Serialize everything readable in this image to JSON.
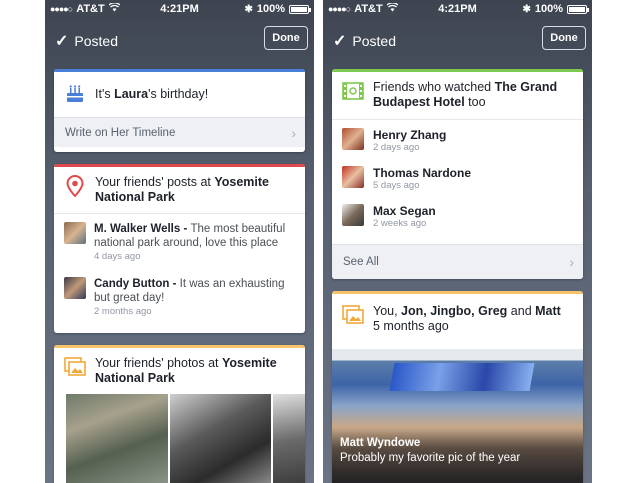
{
  "status": {
    "carrier": "AT&T",
    "time": "4:21PM",
    "battery": "100%"
  },
  "nav": {
    "title": "Posted",
    "done_label": "Done"
  },
  "left": {
    "birthday": {
      "text_prefix": "It's ",
      "name": "Laura",
      "text_suffix": "'s birthday!",
      "footer": "Write on Her Timeline",
      "accent": "#4a7fd8"
    },
    "posts_card": {
      "title_prefix": "Your friends' posts at ",
      "place": "Yosemite National Park",
      "accent": "#e0494b",
      "posts": [
        {
          "name": "M. Walker Wells",
          "sep": " - ",
          "text": "The most beautiful national park around, love this place",
          "time": "4 days ago"
        },
        {
          "name": "Candy Button",
          "sep": " - ",
          "text": "It was an exhausting but great day!",
          "time": "2 months ago"
        }
      ]
    },
    "photos_card": {
      "title_prefix": "Your friends' photos at ",
      "place": "Yosemite National Park",
      "accent": "#f5c36a"
    }
  },
  "right": {
    "watched_card": {
      "title_prefix": "Friends who watched ",
      "movie": "The Grand Budapest Hotel",
      "title_suffix": " too",
      "accent": "#7ec850",
      "people": [
        {
          "name": "Henry Zhang",
          "time": "2 days ago"
        },
        {
          "name": "Thomas Nardone",
          "time": "5 days ago"
        },
        {
          "name": "Max Segan",
          "time": "2 weeks ago"
        }
      ],
      "footer": "See All"
    },
    "group_card": {
      "you": "You, ",
      "names": "Jon, Jingbo, Greg",
      "and": " and ",
      "last": "Matt",
      "time": "5 months ago",
      "accent": "#f5c36a",
      "photo_author": "Matt Wyndowe",
      "photo_caption": "Probably my favorite pic of the year"
    }
  }
}
